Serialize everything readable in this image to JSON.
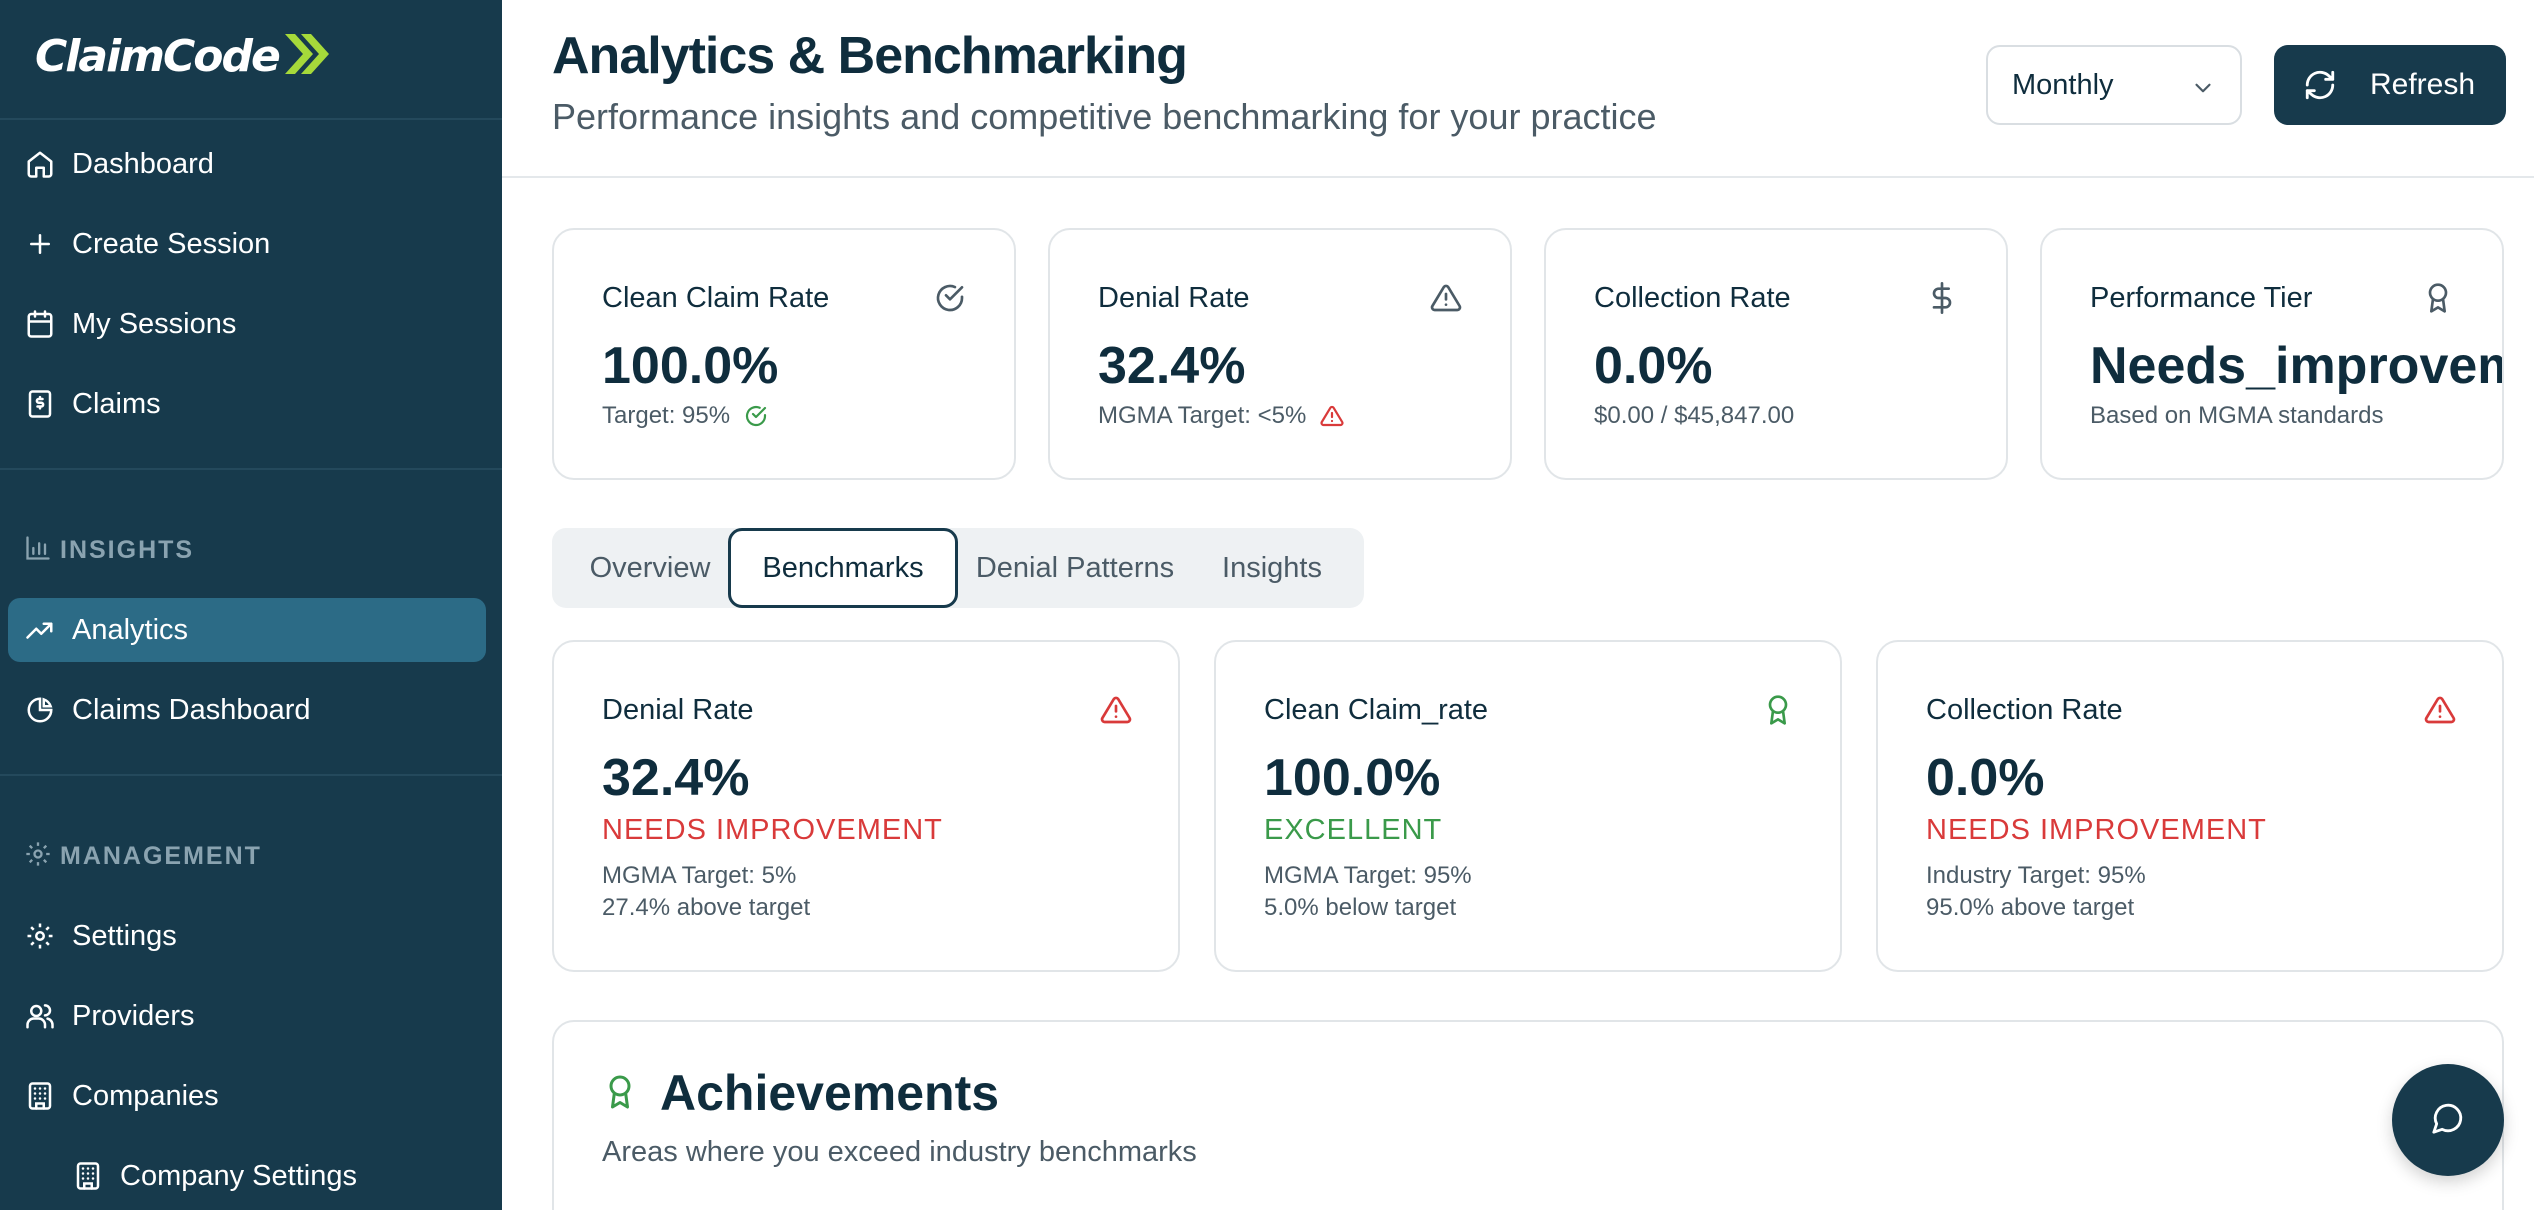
{
  "app": {
    "logo_text": "ClaimCode"
  },
  "sidebar": {
    "main_items": [
      {
        "label": "Dashboard",
        "icon": "home-icon"
      },
      {
        "label": "Create Session",
        "icon": "plus-icon"
      },
      {
        "label": "My Sessions",
        "icon": "calendar-icon"
      },
      {
        "label": "Claims",
        "icon": "receipt-icon"
      }
    ],
    "insights_title": "INSIGHTS",
    "insights_items": [
      {
        "label": "Analytics",
        "icon": "trending-up-icon",
        "active": true
      },
      {
        "label": "Claims Dashboard",
        "icon": "pie-chart-icon"
      }
    ],
    "management_title": "MANAGEMENT",
    "management_items": [
      {
        "label": "Settings",
        "icon": "gear-icon"
      },
      {
        "label": "Providers",
        "icon": "users-icon"
      },
      {
        "label": "Companies",
        "icon": "building-icon"
      },
      {
        "label": "Company Settings",
        "icon": "building-icon"
      }
    ]
  },
  "header": {
    "title": "Analytics & Benchmarking",
    "subtitle": "Performance insights and competitive benchmarking for your practice",
    "period_select": "Monthly",
    "refresh_label": "Refresh"
  },
  "stats": [
    {
      "title": "Clean Claim Rate",
      "value": "100.0%",
      "sub": "Target: 95%",
      "icon": "check-circle-icon"
    },
    {
      "title": "Denial Rate",
      "value": "32.4%",
      "sub": "MGMA Target: <5%",
      "icon": "alert-triangle-icon"
    },
    {
      "title": "Collection Rate",
      "value": "0.0%",
      "sub": "$0.00 / $45,847.00",
      "icon": "dollar-icon"
    },
    {
      "title": "Performance Tier",
      "value": "Needs_improvement",
      "sub": "Based on MGMA standards",
      "icon": "award-icon"
    }
  ],
  "tabs": [
    {
      "label": "Overview"
    },
    {
      "label": "Benchmarks",
      "active": true
    },
    {
      "label": "Denial Patterns"
    },
    {
      "label": "Insights"
    }
  ],
  "benchmarks": [
    {
      "title": "Denial Rate",
      "value": "32.4%",
      "status": "NEEDS IMPROVEMENT",
      "target": "MGMA Target: 5%",
      "diff": "27.4% above target",
      "icon": "alert-triangle-icon"
    },
    {
      "title": "Clean Claim_rate",
      "value": "100.0%",
      "status": "EXCELLENT",
      "target": "MGMA Target: 95%",
      "diff": "5.0% below target",
      "icon": "award-icon"
    },
    {
      "title": "Collection Rate",
      "value": "0.0%",
      "status": "NEEDS IMPROVEMENT",
      "target": "Industry Target: 95%",
      "diff": "95.0% above target",
      "icon": "alert-triangle-icon"
    }
  ],
  "achievements": {
    "title": "Achievements",
    "description": "Areas where you exceed industry benchmarks"
  },
  "colors": {
    "sidebar_bg": "#173a4c",
    "active_nav": "#2c6b86",
    "danger": "#d93a3a",
    "success": "#3a9a4a"
  }
}
